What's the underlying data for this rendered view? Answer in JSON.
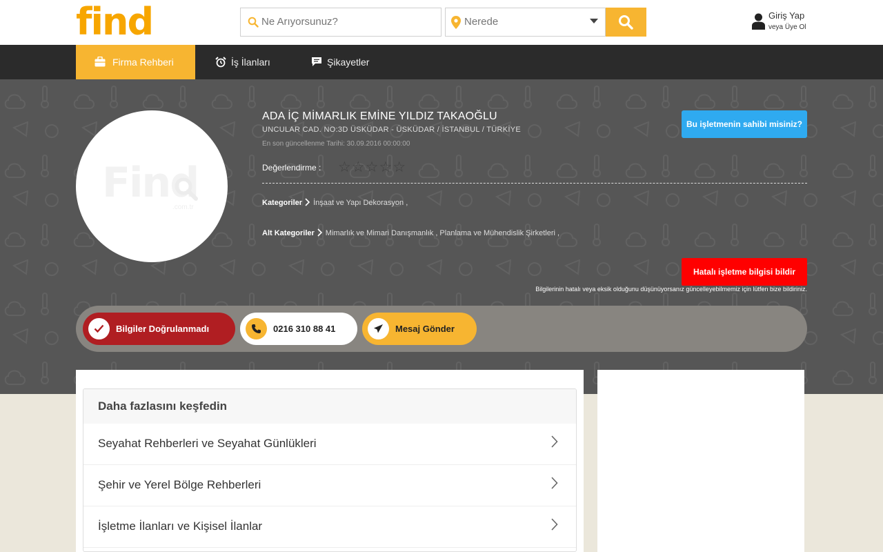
{
  "header": {
    "logo": "find",
    "search_placeholder": "Ne Arıyorsunuz?",
    "location_placeholder": "Nerede",
    "login_title": "Giriş Yap",
    "login_sub": "veya Üye Ol"
  },
  "nav": {
    "items": [
      {
        "label": "Firma Rehberi",
        "icon": "briefcase-icon"
      },
      {
        "label": "İş İlanları",
        "icon": "alarm-clock-icon"
      },
      {
        "label": "Şikayetler",
        "icon": "chat-icon"
      }
    ]
  },
  "business": {
    "name": "ADA İÇ MİMARLIK EMİNE YILDIZ TAKAOĞLU",
    "address": "UNCULAR CAD. NO:3D ÜSKÜDAR - ÜSKÜDAR / İSTANBUL / TÜRKİYE",
    "updated": "En son güncellenme Tarihi: 30.09.2016 00:00:00",
    "owner_button": "Bu işletmenin sahibi misiniz?",
    "rating_label": "Değerlendirme :",
    "rating_value": 0,
    "rating_max": 5,
    "stars": "☆☆☆☆☆",
    "categories_label": "Kategoriler",
    "categories": "İnşaat ve Yapı Dekorasyon ,",
    "subcategories_label": "Alt Kategoriler",
    "subcategories": "Mimarlık ve Mimari Danışmanlık , Planlama ve Mühendislik Şirketleri ,",
    "report_button": "Hatalı işletme bilgisi bildir",
    "report_note": "Bilgilerinin hatalı veya eksik olduğunu düşünüyorsanız güncelleyebilmemiz için lütfen bize bildiriniz.",
    "avatar_watermark": "Find",
    "avatar_watermark_sub": ".com.tr"
  },
  "actions": {
    "verify": "Bilgiler Doğrulanmadı",
    "phone": "0216 310 88 41",
    "message": "Mesaj Gönder"
  },
  "explore": {
    "title": "Daha fazlasını keşfedin",
    "items": [
      "Seyahat Rehberleri ve Seyahat Günlükleri",
      "Şehir ve Yerel Bölge Rehberleri",
      "İşletme İlanları ve Kişisel İlanlar"
    ]
  },
  "colors": {
    "brand": "#f7a600",
    "accent": "#f7b531",
    "nav_bg": "#2b2b2b",
    "hero_bg": "#565656",
    "owner_btn": "#2faaf0",
    "report_btn": "#ff0000",
    "verify_pill": "#b01e22"
  }
}
